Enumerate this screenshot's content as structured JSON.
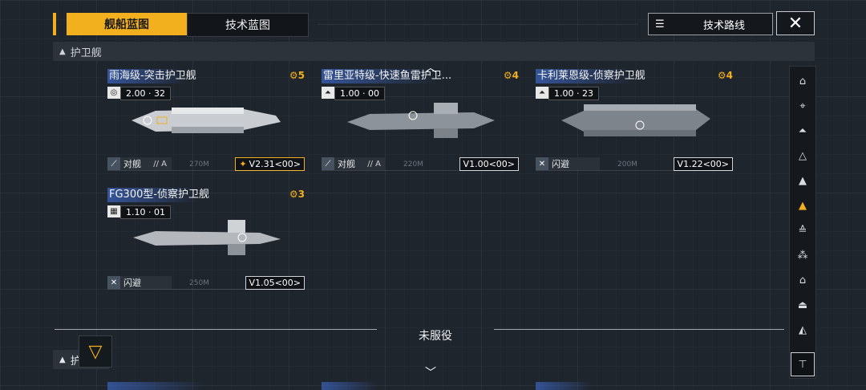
{
  "tabs": {
    "active": "舰船蓝图",
    "inactive": "技术蓝图"
  },
  "tech_route": {
    "label": "技术路线",
    "icon": "list-icon"
  },
  "close": {
    "glyph": "✕"
  },
  "section": {
    "label": "护卫舰",
    "glyph": "▲"
  },
  "section2": {
    "label": "护",
    "glyph": "▲"
  },
  "status_divider": "未服役",
  "cards": [
    {
      "title": "雨海级-突击护卫舰",
      "stars": "5",
      "version": "2.00 · 32",
      "role": "对舰",
      "role_class": "// A",
      "range": "270M",
      "tag": "V2.31<00>"
    },
    {
      "title": "雷里亚特级-快速鱼雷护卫...",
      "stars": "4",
      "version": "1.00 · 00",
      "role": "对舰",
      "role_class": "// A",
      "range": "220M",
      "tag": "V1.00<00>"
    },
    {
      "title": "卡利莱恩级-侦察护卫舰",
      "stars": "4",
      "version": "1.00 · 23",
      "role": "闪避",
      "role_class": "",
      "range": "200M",
      "tag": "V1.22<00>"
    },
    {
      "title": "FG300型-侦察护卫舰",
      "stars": "3",
      "version": "1.10 · 01",
      "role": "闪避",
      "role_class": "",
      "range": "250M",
      "tag": "V1.05<00>"
    }
  ],
  "sidebar": [
    "⌂",
    "⌖",
    "⏶",
    "△",
    "▲",
    "▲",
    "≙",
    "⁂",
    "⌂",
    "⏏",
    "◭",
    "⊤"
  ],
  "colors": {
    "accent": "#f2b01e",
    "title_bar": "#3c64be"
  }
}
